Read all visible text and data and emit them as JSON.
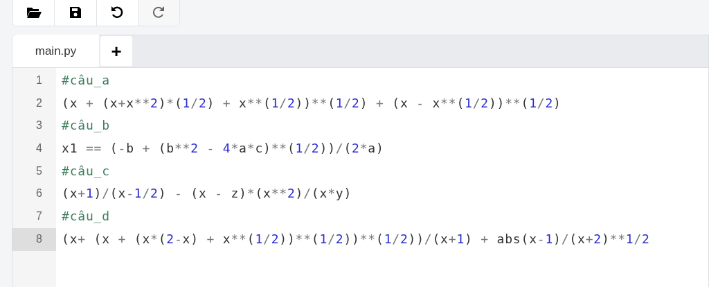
{
  "toolbar": [
    {
      "kind": "open",
      "disabled": false
    },
    {
      "kind": "save",
      "disabled": false
    },
    {
      "kind": "undo",
      "disabled": false
    },
    {
      "kind": "redo",
      "disabled": true
    }
  ],
  "tabs": [
    {
      "label": "main.py",
      "selected": true
    }
  ],
  "new_tab_button": "+",
  "editor": {
    "lines": [
      {
        "number": "1",
        "kind": "comment",
        "text": "#câu_a",
        "selected": false
      },
      {
        "number": "2",
        "kind": "code",
        "text": "(x + (x+x**2)*(1/2) + x**(1/2))**(1/2) + (x - x**(1/2))**(1/2)",
        "selected": false
      },
      {
        "number": "3",
        "kind": "comment",
        "text": "#câu_b",
        "selected": false
      },
      {
        "number": "4",
        "kind": "code",
        "text": "x1 == (-b + (b**2 - 4*a*c)**(1/2))/(2*a)",
        "selected": false
      },
      {
        "number": "5",
        "kind": "comment",
        "text": "#câu_c",
        "selected": false
      },
      {
        "number": "6",
        "kind": "code",
        "text": "(x+1)/(x-1/2) - (x - z)*(x**2)/(x*y)",
        "selected": false
      },
      {
        "number": "7",
        "kind": "comment",
        "text": "#câu_d",
        "selected": false
      },
      {
        "number": "8",
        "kind": "code",
        "text": "(x+ (x + (x*(2-x) + x**(1/2))**(1/2))**(1/2))/(x+1) + abs(x-1)/(x+2)**1/2",
        "selected": true
      }
    ]
  }
}
